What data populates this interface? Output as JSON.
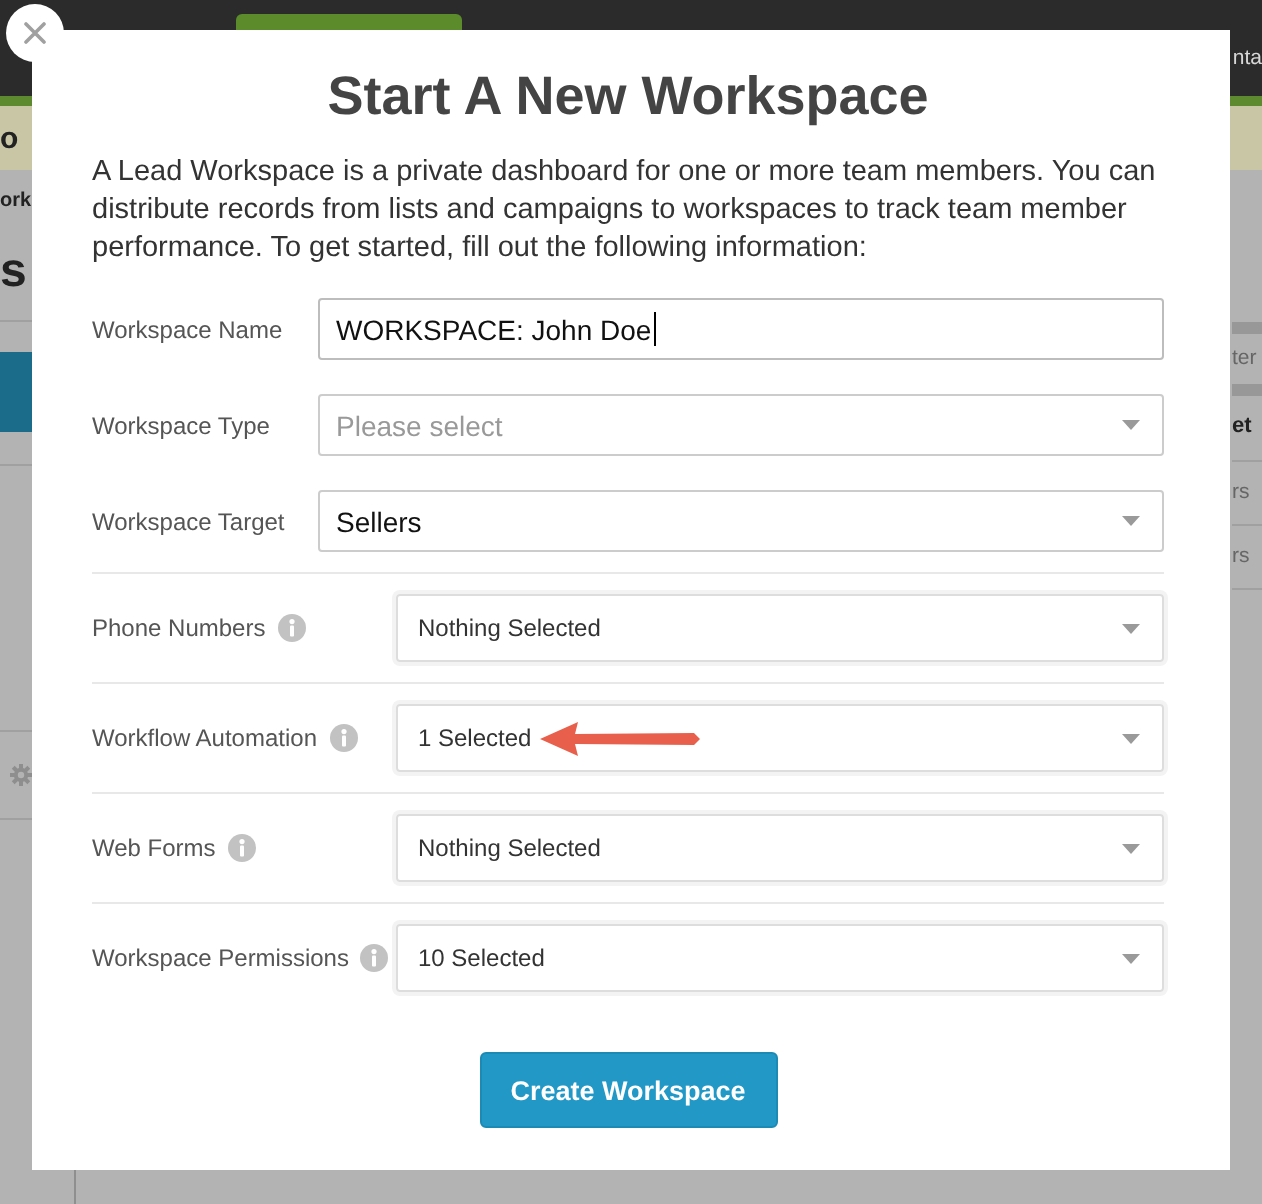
{
  "background_page": {
    "top_bar": {
      "text": "nta"
    },
    "banner": {
      "text": "o"
    },
    "left_panel": {
      "heading": "ork",
      "title": "s"
    },
    "right_table": {
      "filter_text": "ter",
      "column_header": "et",
      "cells": [
        "rs",
        "rs"
      ]
    }
  },
  "dialog": {
    "title": "Start A New Workspace",
    "description": "A Lead Workspace is a private dashboard for one or more team members. You can distribute records from lists and campaigns to workspaces to track team member performance. To get started, fill out the following information:",
    "fields": [
      {
        "kind": "text",
        "label": "Workspace Name",
        "value": "WORKSPACE: John Doe",
        "focused": true,
        "annotated": false
      },
      {
        "kind": "select",
        "label": "Workspace Type",
        "placeholder": "Please select",
        "focused": false,
        "annotated": false
      },
      {
        "kind": "select",
        "label": "Workspace Target",
        "value": "Sellers",
        "focused": false,
        "annotated": false
      },
      {
        "kind": "multiselect",
        "label": "Phone Numbers",
        "value": "Nothing Selected",
        "focused": false,
        "annotated": false
      },
      {
        "kind": "multiselect",
        "label": "Workflow Automation",
        "value": "1 Selected",
        "focused": false,
        "annotated": true
      },
      {
        "kind": "multiselect",
        "label": "Web Forms",
        "value": "Nothing Selected",
        "focused": false,
        "annotated": false
      },
      {
        "kind": "multiselect",
        "label": "Workspace Permissions",
        "value": "10 Selected",
        "focused": false,
        "annotated": false
      }
    ],
    "submit_button": "Create Workspace"
  }
}
